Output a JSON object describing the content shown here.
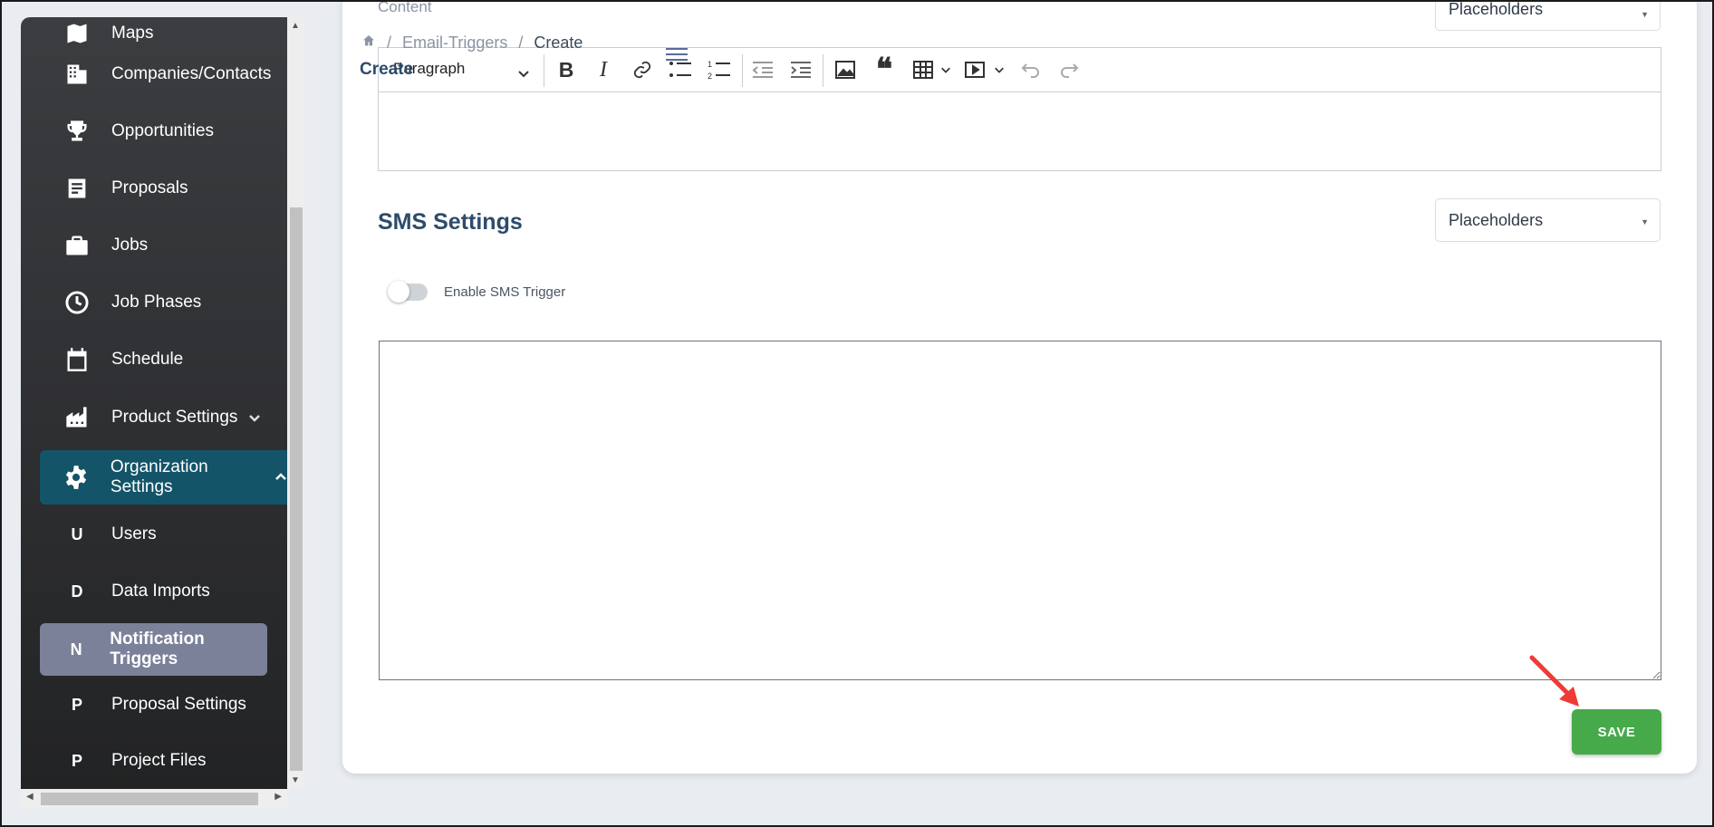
{
  "sidebar": {
    "items": [
      {
        "label": "Maps",
        "icon": "map-icon"
      },
      {
        "label": "Companies/Contacts",
        "icon": "building-icon"
      },
      {
        "label": "Opportunities",
        "icon": "trophy-icon"
      },
      {
        "label": "Proposals",
        "icon": "document-icon"
      },
      {
        "label": "Jobs",
        "icon": "briefcase-icon"
      },
      {
        "label": "Job Phases",
        "icon": "clock-icon"
      },
      {
        "label": "Schedule",
        "icon": "calendar-icon"
      },
      {
        "label": "Product Settings",
        "icon": "factory-icon"
      },
      {
        "label": "Organization Settings",
        "icon": "gear-icon"
      }
    ],
    "sub_items": [
      {
        "letter": "U",
        "label": "Users"
      },
      {
        "letter": "D",
        "label": "Data Imports"
      },
      {
        "letter": "N",
        "label": "Notification Triggers"
      },
      {
        "letter": "P",
        "label": "Proposal Settings"
      },
      {
        "letter": "P",
        "label": "Project Files"
      }
    ]
  },
  "breadcrumb": {
    "parent": "Email-Triggers",
    "sep": "/",
    "current": "Create"
  },
  "page_title": "Create",
  "content": {
    "label": "Content",
    "placeholder_select": "Placeholders",
    "editor": {
      "block_format": "Paragraph"
    }
  },
  "sms": {
    "title": "SMS Settings",
    "placeholder_select": "Placeholders",
    "toggle_label": "Enable SMS Trigger",
    "message": ""
  },
  "save_label": "SAVE",
  "colors": {
    "active_parent": "#145468",
    "active_child": "#7b8199",
    "save": "#46a94a",
    "heading": "#2e4b6b"
  }
}
